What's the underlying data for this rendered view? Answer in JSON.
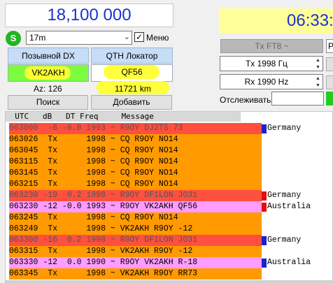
{
  "radio": {
    "frequency": "18,100 000",
    "status_badge": "S",
    "band": "17m",
    "menu_checked": "✓",
    "menu_label": "Меню"
  },
  "dx": {
    "call_header": "Позывной DX",
    "locator_header": "QTH Локатор",
    "call": "VK2AKH",
    "locator": "QF56",
    "azimuth": "Az: 126",
    "distance": "11721 km",
    "search_button": "Поиск",
    "add_button": "Добавить"
  },
  "right": {
    "clock": "06:33:",
    "tx_mode": "Tx FT8 ~",
    "edge_letter": "P",
    "tx_freq": "Tx  1998  Гц",
    "rx_freq": "Rx  1990  Hz",
    "track_label": "Отслеживать:",
    "indicator_color": "#22cc22"
  },
  "list": {
    "header": "  UTC   dB   DT Freq     Message",
    "colors": {
      "orange": "#ff9a00",
      "red": "#ff4f3f",
      "pink": "#ff9cff",
      "flag_blue": "#1b22cc",
      "flag_red": "#e01010"
    },
    "rows": [
      {
        "text": "063000  -6 -0.0 1993 ~ R9OY DJ2TS 73",
        "bg": "red",
        "textcolor": "#555555",
        "flag": "blue",
        "country": "Germany"
      },
      {
        "text": "063026  Tx      1998 ~ CQ R9OY NO14",
        "bg": "orange",
        "textcolor": "#000000",
        "flag": "",
        "country": ""
      },
      {
        "text": "063045  Tx      1998 ~ CQ R9OY NO14",
        "bg": "orange",
        "textcolor": "#000000",
        "flag": "",
        "country": ""
      },
      {
        "text": "063115  Tx      1998 ~ CQ R9OY NO14",
        "bg": "orange",
        "textcolor": "#000000",
        "flag": "",
        "country": ""
      },
      {
        "text": "063145  Tx      1998 ~ CQ R9OY NO14",
        "bg": "orange",
        "textcolor": "#000000",
        "flag": "",
        "country": ""
      },
      {
        "text": "063215  Tx      1998 ~ CQ R9OY NO14",
        "bg": "orange",
        "textcolor": "#000000",
        "flag": "",
        "country": ""
      },
      {
        "text": "063230 -19  0.2 1998 ~ R9OY DF1LON JO31",
        "bg": "red",
        "textcolor": "#555555",
        "flag": "red",
        "country": "Germany"
      },
      {
        "text": "063230 -12 -0.0 1993 ~ R9OY VK2AKH QF56",
        "bg": "pink",
        "textcolor": "#000000",
        "flag": "red",
        "country": "Australia"
      },
      {
        "text": "063245  Tx      1998 ~ CQ R9OY NO14",
        "bg": "orange",
        "textcolor": "#000000",
        "flag": "",
        "country": ""
      },
      {
        "text": "063249  Tx      1998 ~ VK2AKH R9OY -12",
        "bg": "orange",
        "textcolor": "#000000",
        "flag": "",
        "country": ""
      },
      {
        "text": "063300 -16  0.2 1998 ~ R9OY DF1LON JO31",
        "bg": "red",
        "textcolor": "#555555",
        "flag": "blue",
        "country": "Germany"
      },
      {
        "text": "063315  Tx      1998 ~ VK2AKH R9OY -12",
        "bg": "orange",
        "textcolor": "#000000",
        "flag": "",
        "country": ""
      },
      {
        "text": "063330 -12  0.0 1990 ~ R9OY VK2AKH R-18",
        "bg": "pink",
        "textcolor": "#000000",
        "flag": "blue",
        "country": "Australia"
      },
      {
        "text": "063345  Tx      1998 ~ VK2AKH R9OY RR73",
        "bg": "orange",
        "textcolor": "#000000",
        "flag": "",
        "country": ""
      }
    ]
  }
}
